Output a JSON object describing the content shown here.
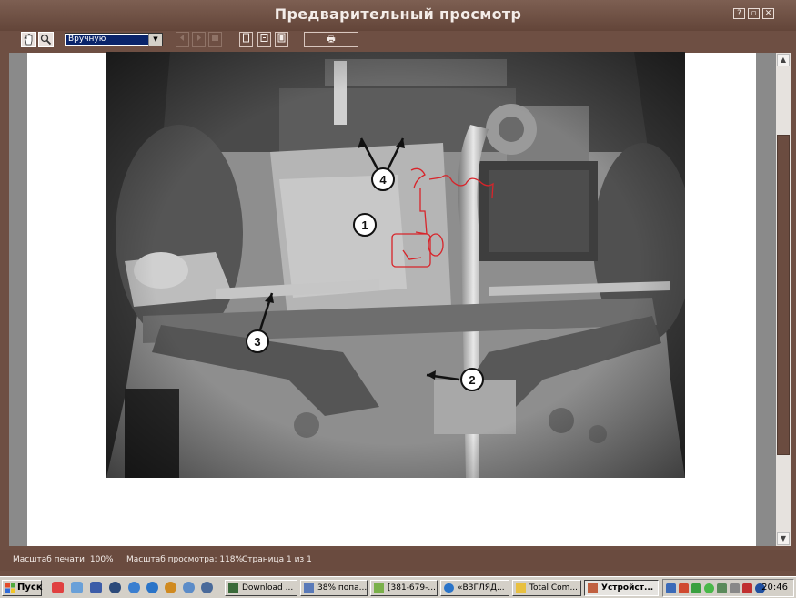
{
  "window": {
    "title": "Предварительный просмотр",
    "caption_buttons": {
      "help": "?",
      "restore": "▫",
      "close": "✕"
    }
  },
  "toolbar": {
    "hand_icon": "hand-icon",
    "zoom_icon": "magnifier-icon",
    "zoom_mode": "Вручную",
    "print_glyph": "🖶"
  },
  "document": {
    "figure_labels": [
      "1",
      "2",
      "3",
      "4"
    ]
  },
  "statusbar": {
    "print_scale": "Масштаб печати: 100%",
    "view_scale": "Масштаб просмотра: 118%",
    "page": "Страница 1 из 1"
  },
  "taskbar": {
    "start_label": "Пуск",
    "tasks": [
      {
        "label": "Download ...",
        "active": false
      },
      {
        "label": "38% попа...",
        "active": false
      },
      {
        "label": "[381-679-...",
        "active": false
      },
      {
        "label": "«ВЗГЛЯД...",
        "active": false
      },
      {
        "label": "Total Com...",
        "active": false
      },
      {
        "label": "Устройст...",
        "active": true
      }
    ],
    "clock": "20:46"
  },
  "colors": {
    "frame": "#6e4f43",
    "selection": "#0a246a",
    "annotation": "#d8242a"
  }
}
